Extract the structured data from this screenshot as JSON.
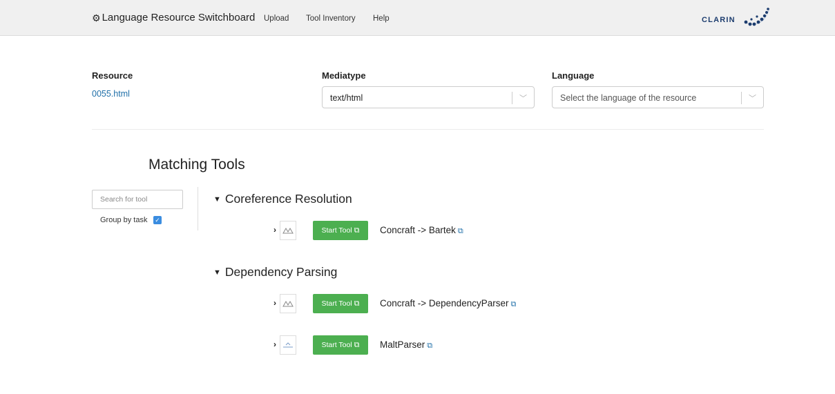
{
  "navbar": {
    "brand": "Language Resource Switchboard",
    "brand_icon": "gear-icon",
    "links": [
      "Upload",
      "Tool Inventory",
      "Help"
    ],
    "logo_text": "CLARIN"
  },
  "resource": {
    "label": "Resource",
    "file": "0055.html"
  },
  "mediatype": {
    "label": "Mediatype",
    "value": "text/html"
  },
  "language": {
    "label": "Language",
    "placeholder": "Select the language of the resource"
  },
  "matching": {
    "title": "Matching Tools",
    "search_placeholder": "Search for tool",
    "group_by_task_label": "Group by task",
    "group_by_task_checked": true
  },
  "tasks": [
    {
      "name": "Coreference Resolution",
      "tools": [
        {
          "start_label": "Start Tool",
          "name": "Concraft -> Bartek"
        }
      ]
    },
    {
      "name": "Dependency Parsing",
      "tools": [
        {
          "start_label": "Start Tool",
          "name": "Concraft -> DependencyParser"
        },
        {
          "start_label": "Start Tool",
          "name": "MaltParser"
        }
      ]
    }
  ],
  "colors": {
    "start_button": "#4caf50",
    "link": "#1f6fa8",
    "navbar": "#f0f0f0"
  }
}
